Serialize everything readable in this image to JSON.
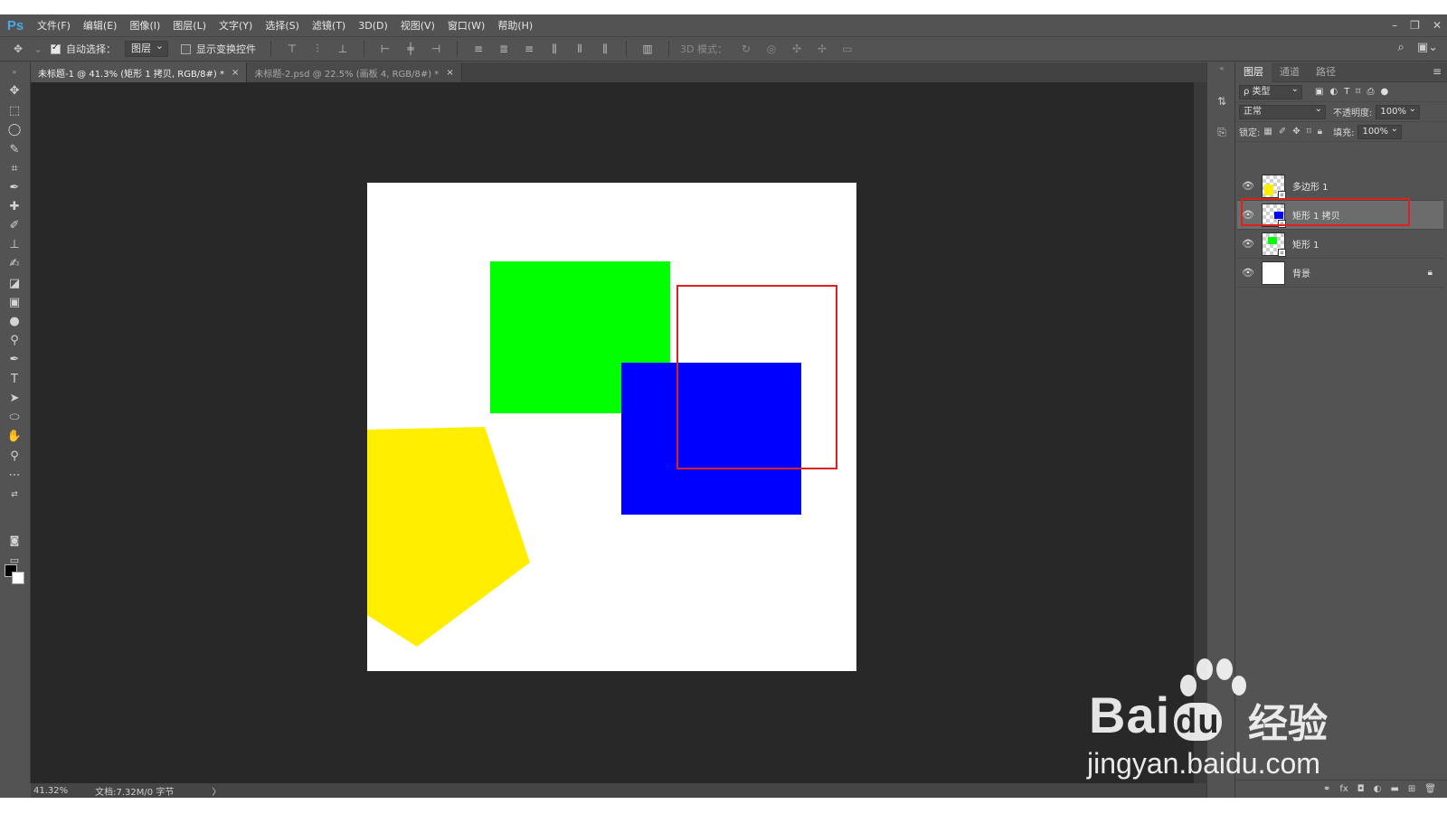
{
  "app": {
    "logo": "Ps"
  },
  "menu": [
    "文件(F)",
    "编辑(E)",
    "图像(I)",
    "图层(L)",
    "文字(Y)",
    "选择(S)",
    "滤镜(T)",
    "3D(D)",
    "视图(V)",
    "窗口(W)",
    "帮助(H)"
  ],
  "window_controls": {
    "minimize": "–",
    "restore": "❐",
    "close": "✕"
  },
  "options": {
    "auto_select_label": "自动选择：",
    "auto_select_checked": true,
    "auto_select_target": "图层",
    "show_transform_label": "显示变换控件",
    "show_transform_checked": false,
    "mode_3d_label": "3D 模式："
  },
  "tabs": [
    {
      "title": "未标题-1 @ 41.3% (矩形 1 拷贝, RGB/8#) *",
      "active": true,
      "close": "×"
    },
    {
      "title": "未标题-2.psd @ 22.5% (画板 4, RGB/8#) *",
      "active": false,
      "close": "×"
    }
  ],
  "canvas": {
    "background": "#ffffff",
    "shapes": [
      {
        "name": "rect-green",
        "color": "#00ff00"
      },
      {
        "name": "rect-blue",
        "color": "#0000ff"
      },
      {
        "name": "polygon-yellow",
        "color": "#ffee00"
      }
    ],
    "highlight_color": "#e0201e"
  },
  "status": {
    "zoom": "41.32%",
    "doc": "文档:7.32M/0 字节",
    "arrow": "〉"
  },
  "layers_panel": {
    "tabs": [
      {
        "label": "图层",
        "active": true
      },
      {
        "label": "通道",
        "active": false
      },
      {
        "label": "路径",
        "active": false
      }
    ],
    "filter_label": "ρ 类型",
    "blend_mode": "正常",
    "opacity_label": "不透明度:",
    "opacity_value": "100%",
    "lock_label": "锁定:",
    "fill_label": "填充:",
    "fill_value": "100%",
    "layers": [
      {
        "name": "多边形 1",
        "visible": true,
        "selected": false,
        "thumb": "yellow",
        "locked": false
      },
      {
        "name": "矩形 1 拷贝",
        "visible": true,
        "selected": true,
        "thumb": "blue",
        "locked": false
      },
      {
        "name": "矩形 1",
        "visible": true,
        "selected": false,
        "thumb": "green",
        "locked": false
      },
      {
        "name": "背景",
        "visible": true,
        "selected": false,
        "thumb": "white",
        "locked": true
      }
    ]
  },
  "watermark": {
    "brand": "Bai",
    "brand_du": "du",
    "cn": "经验",
    "url": "jingyan.baidu.com"
  }
}
